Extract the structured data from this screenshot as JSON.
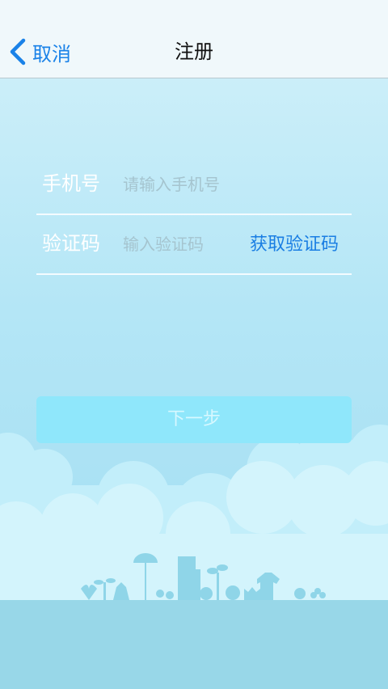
{
  "nav": {
    "back_label": "取消",
    "title": "注册"
  },
  "form": {
    "phone_label": "手机号",
    "phone_placeholder": "请输入手机号",
    "phone_value": "",
    "code_label": "验证码",
    "code_placeholder": "输入验证码",
    "code_value": "",
    "get_code_label": "获取验证码"
  },
  "next_label": "下一步",
  "colors": {
    "accent": "#1a82e8",
    "button_bg": "#8fe7fb",
    "button_text": "#d7f8ff",
    "cloud": "#c7f0fb",
    "ground": "#98d7e8"
  },
  "icons": [
    "chevron-left-icon"
  ]
}
